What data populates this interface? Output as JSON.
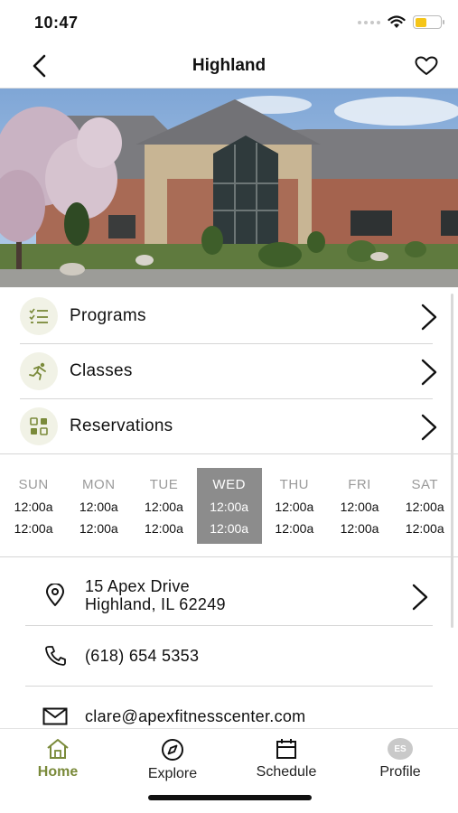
{
  "status_bar": {
    "time": "10:47"
  },
  "nav": {
    "title": "Highland"
  },
  "menu": [
    {
      "label": "Programs",
      "icon": "list-check-icon"
    },
    {
      "label": "Classes",
      "icon": "runner-icon"
    },
    {
      "label": "Reservations",
      "icon": "grid-icon"
    }
  ],
  "hours": {
    "active_day": "WED",
    "days": [
      {
        "name": "SUN",
        "open": "12:00a",
        "close": "12:00a"
      },
      {
        "name": "MON",
        "open": "12:00a",
        "close": "12:00a"
      },
      {
        "name": "TUE",
        "open": "12:00a",
        "close": "12:00a"
      },
      {
        "name": "WED",
        "open": "12:00a",
        "close": "12:00a"
      },
      {
        "name": "THU",
        "open": "12:00a",
        "close": "12:00a"
      },
      {
        "name": "FRI",
        "open": "12:00a",
        "close": "12:00a"
      },
      {
        "name": "SAT",
        "open": "12:00a",
        "close": "12:00a"
      }
    ]
  },
  "contact": {
    "address_line1": "15 Apex Drive",
    "address_line2": "Highland, IL 62249",
    "phone": "(618) 654 5353",
    "email": "clare@apexfitnesscenter.com"
  },
  "tabs": {
    "home": "Home",
    "explore": "Explore",
    "schedule": "Schedule",
    "profile": "Profile",
    "profile_initials": "ES"
  },
  "colors": {
    "accent": "#7a8a3a",
    "icon_bg": "#f1f2e6",
    "active_day_bg": "#8c8c8c",
    "battery": "#f5c518"
  }
}
